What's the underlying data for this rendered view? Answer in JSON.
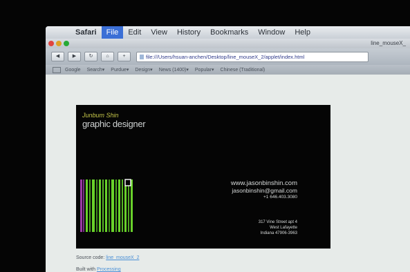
{
  "menubar": {
    "items": [
      "Safari",
      "File",
      "Edit",
      "View",
      "History",
      "Bookmarks",
      "Window",
      "Help"
    ],
    "active": "File"
  },
  "window": {
    "title": "line_mouseX_"
  },
  "toolbar": {
    "url": "file:///Users/hsuan-anchen/Desktop/line_mouseX_2/applet/index.html"
  },
  "bookmarks": [
    "Google",
    "Search▾",
    "Purdue▾",
    "Design▾",
    "News (1400)▾",
    "Popular▾",
    "Chinese (Traditional)"
  ],
  "card": {
    "name": "Junbum Shin",
    "role": "graphic designer",
    "website": "www.jasonbinshin.com",
    "email": "jasonbinshin@gmail.com",
    "phone": "+1 646.403.3080",
    "address_line1": "317 Vine Street apt 4",
    "address_line2": "West Lafayette",
    "address_line3": "Indiana 47906-3963"
  },
  "footer": {
    "source_label": "Source code:",
    "source_link": "line_mouseX_2",
    "built_label": "Built with",
    "built_link": "Processing"
  },
  "colors": {
    "card_background": "#050505",
    "name_accent": "#c7c84a",
    "barcode_green": "#69d12a",
    "barcode_purple": "#9b3aa5",
    "active_menu": "#3b6fd6"
  }
}
